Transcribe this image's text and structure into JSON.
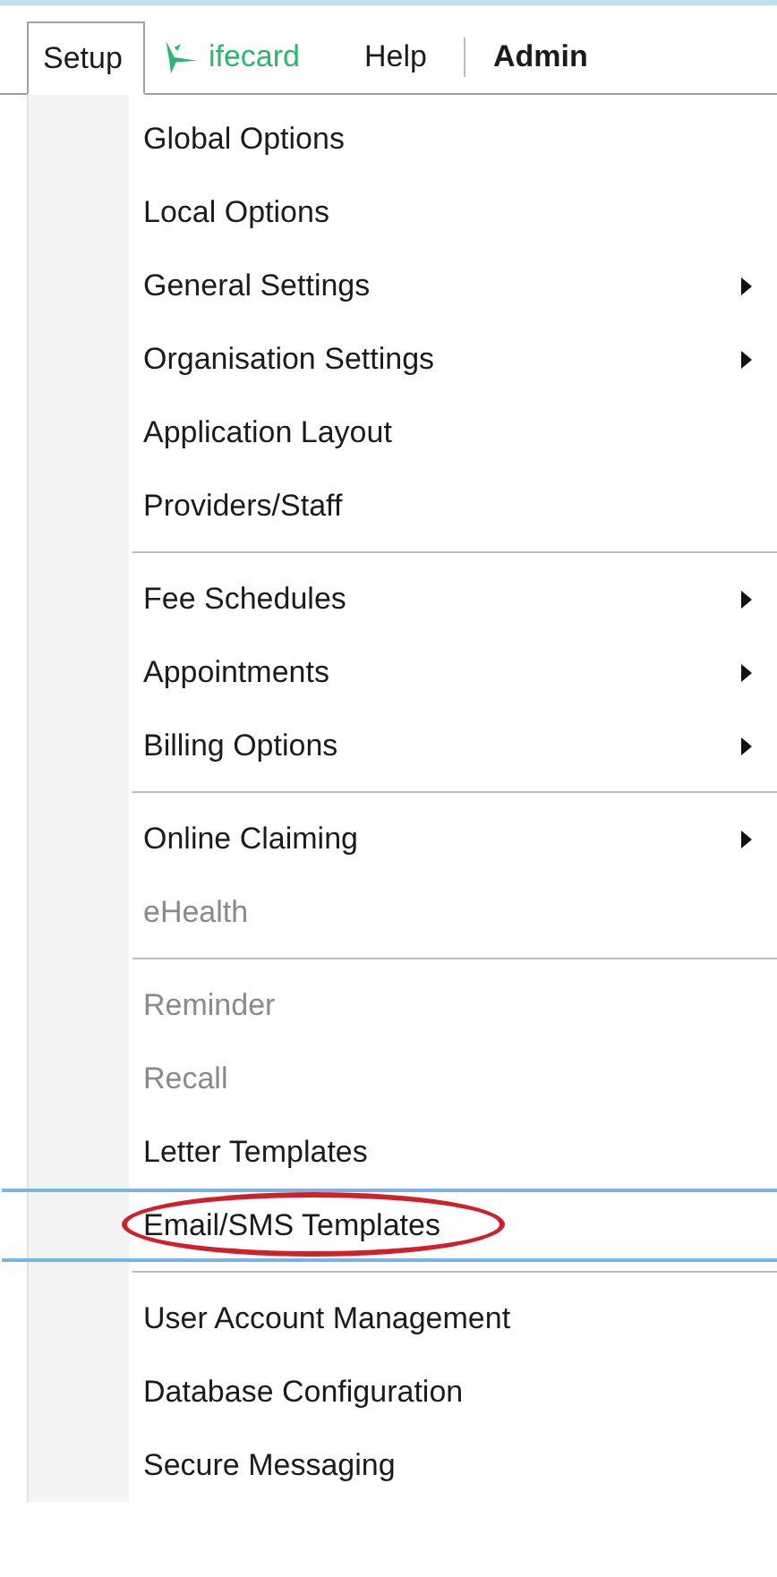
{
  "menu_bar": [
    {
      "kind": "menu",
      "label": "Setup",
      "selected": true
    },
    {
      "kind": "logo",
      "label": "ifecard",
      "selected": false
    },
    {
      "kind": "menu",
      "label": "Help",
      "selected": false
    },
    {
      "kind": "divider"
    },
    {
      "kind": "strong",
      "label": "Admin",
      "selected": false
    }
  ],
  "menu": [
    {
      "kind": "item",
      "label": "Global Options",
      "disabled": false,
      "submenu": false
    },
    {
      "kind": "item",
      "label": "Local Options",
      "disabled": false,
      "submenu": false
    },
    {
      "kind": "item",
      "label": "General Settings",
      "disabled": false,
      "submenu": true
    },
    {
      "kind": "item",
      "label": "Organisation Settings",
      "disabled": false,
      "submenu": true
    },
    {
      "kind": "item",
      "label": "Application Layout",
      "disabled": false,
      "submenu": false
    },
    {
      "kind": "item",
      "label": "Providers/Staff",
      "disabled": false,
      "submenu": false
    },
    {
      "kind": "separator"
    },
    {
      "kind": "item",
      "label": "Fee Schedules",
      "disabled": false,
      "submenu": true
    },
    {
      "kind": "item",
      "label": "Appointments",
      "disabled": false,
      "submenu": true
    },
    {
      "kind": "item",
      "label": "Billing Options",
      "disabled": false,
      "submenu": true
    },
    {
      "kind": "separator"
    },
    {
      "kind": "item",
      "label": "Online Claiming",
      "disabled": false,
      "submenu": true
    },
    {
      "kind": "item",
      "label": "eHealth",
      "disabled": true,
      "submenu": false
    },
    {
      "kind": "separator"
    },
    {
      "kind": "item",
      "label": "Reminder",
      "disabled": true,
      "submenu": false
    },
    {
      "kind": "item",
      "label": "Recall",
      "disabled": true,
      "submenu": false
    },
    {
      "kind": "item",
      "label": "Letter Templates",
      "disabled": false,
      "submenu": false
    },
    {
      "kind": "item",
      "label": "Email/SMS Templates",
      "disabled": false,
      "submenu": false,
      "selected": true,
      "circled": true
    },
    {
      "kind": "separator"
    },
    {
      "kind": "item",
      "label": "User Account Management",
      "disabled": false,
      "submenu": false
    },
    {
      "kind": "item",
      "label": "Database Configuration",
      "disabled": false,
      "submenu": false
    },
    {
      "kind": "item",
      "label": "Secure Messaging",
      "disabled": false,
      "submenu": false
    }
  ]
}
